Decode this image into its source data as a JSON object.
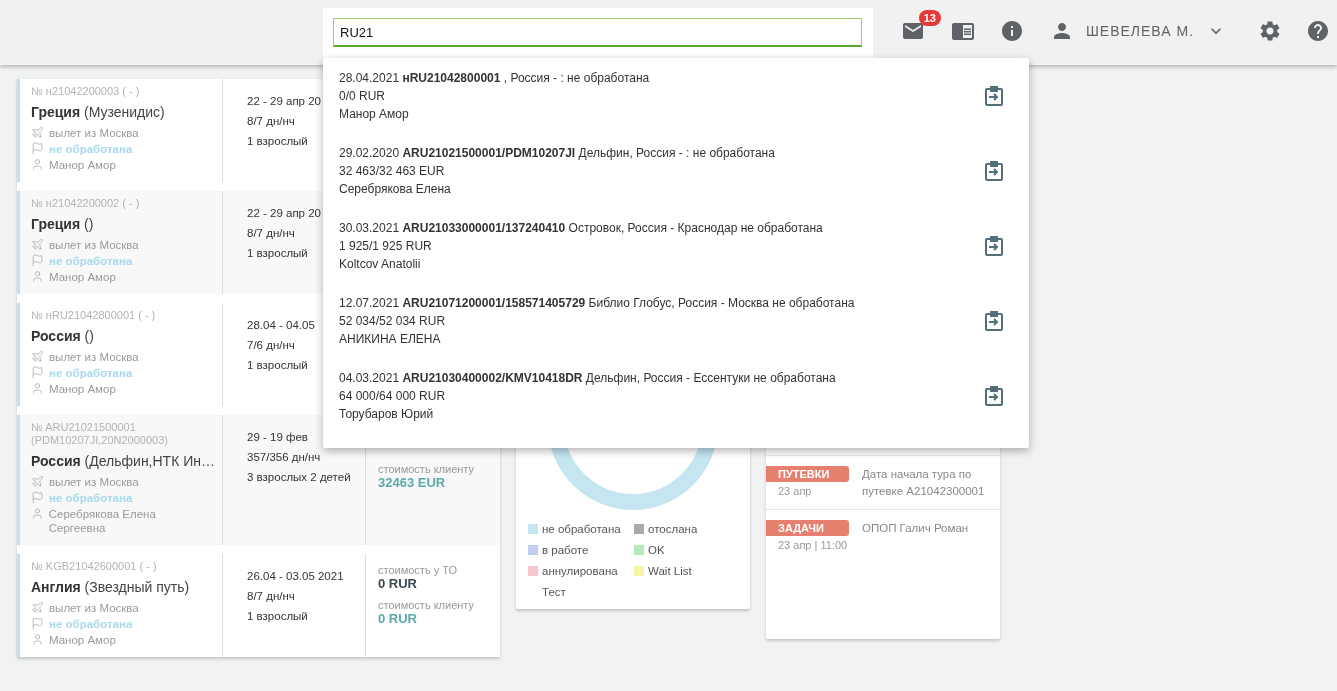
{
  "header": {
    "search": {
      "value": "RU21"
    },
    "mail_badge": "13",
    "user": "ШЕВЕЛЕВА М."
  },
  "orders": [
    {
      "number": "№ н21042200003 ( - )",
      "country": "Греция",
      "operator": "(Музенидис)",
      "dates": "22 - 29 апр 20",
      "nights": "8/7 дн/нч",
      "travelers": "1 взрослый",
      "departure": "вылет из Москва",
      "status": "не обработана",
      "manager": "Манор Амор"
    },
    {
      "number": "№ н21042200002 ( - )",
      "country": "Греция",
      "operator": "()",
      "dates": "22 - 29 апр 20",
      "nights": "8/7 дн/нч",
      "travelers": "1 взрослый",
      "departure": "вылет из Москва",
      "status": "не обработана",
      "manager": "Манор Амор"
    },
    {
      "number": "№ нRU21042800001 ( - )",
      "country": "Россия",
      "operator": "()",
      "dates": "28.04 - 04.05",
      "nights": "7/6 дн/нч",
      "travelers": "1 взрослый",
      "departure": "вылет из Москва",
      "status": "не обработана",
      "manager": "Манор Амор"
    },
    {
      "number": "№ ARU21021500001 (PDM10207JI,20N2000003)",
      "country": "Россия",
      "operator": "(Дельфин,НТК Ин…",
      "dates": "29 - 19 фев",
      "nights": "357/356 дн/нч",
      "travelers": "3 взрослых 2 детей",
      "departure": "вылет из Москва",
      "status": "не обработана",
      "manager": "Серебрякова Елена Сергеевна",
      "prices": [
        {
          "kind": "client",
          "label": "стоимость клиенту",
          "value": "32463 EUR"
        }
      ]
    },
    {
      "number": "№ KGB21042600001 ( - )",
      "country": "Англия",
      "operator": "(Звездный путь)",
      "dates": "26.04 - 03.05 2021",
      "nights": "8/7 дн/нч",
      "travelers": "1 взрослый",
      "departure": "вылет из Москва",
      "status": "не обработана",
      "manager": "Манор Амор",
      "prices": [
        {
          "kind": "operator",
          "label": "стоимость у ТО",
          "value": "0 RUR"
        },
        {
          "kind": "client",
          "label": "стоимость клиенту",
          "value": "0 RUR"
        }
      ]
    }
  ],
  "status_legend": [
    {
      "label": "не обработана",
      "color": "#c5e5f1"
    },
    {
      "label": "отослана",
      "color": "#a9a9a9"
    },
    {
      "label": "в работе",
      "color": "#c3cdf2"
    },
    {
      "label": "OK",
      "color": "#b5ebbd"
    },
    {
      "label": "аннулирована",
      "color": "#f7c3cc"
    },
    {
      "label": "Wait List",
      "color": "#f7f4a8"
    },
    {
      "label": "Тест"
    }
  ],
  "feed": [
    {
      "tag": "ПУТЕВКИ",
      "date": "23 апр",
      "text": "Дата начала тура по путевке A21042300001"
    },
    {
      "tag": "ЗАДАЧИ",
      "date": "23 апр | 11:00",
      "text": "ОПОП Галич Роман"
    }
  ],
  "search_results": [
    {
      "line": "28.04.2021 **нRU21042800001** , Россия - : не обработана",
      "amount": "0/0 RUR",
      "person": "Манор Амор"
    },
    {
      "line": "29.02.2020 **ARU21021500001/PDM10207JI** Дельфин, Россия - : не обработана",
      "amount": "32 463/32 463 EUR",
      "person": "Серебрякова Елена"
    },
    {
      "line": "30.03.2021 **ARU21033000001/137240410** Островок, Россия - Краснодар не обработана",
      "amount": "1 925/1 925 RUR",
      "person": "Koltcov Anatolii"
    },
    {
      "line": "12.07.2021 **ARU21071200001/158571405729** Библио Глобус, Россия - Москва не обработана",
      "amount": "52 034/52 034 RUR",
      "person": "АНИКИНА ЕЛЕНА"
    },
    {
      "line": "04.03.2021 **ARU21030400002/KMV10418DR** Дельфин, Россия - Ессентуки не обработана",
      "amount": "64 000/64 000 RUR",
      "person": "Торубаров Юрий"
    }
  ]
}
